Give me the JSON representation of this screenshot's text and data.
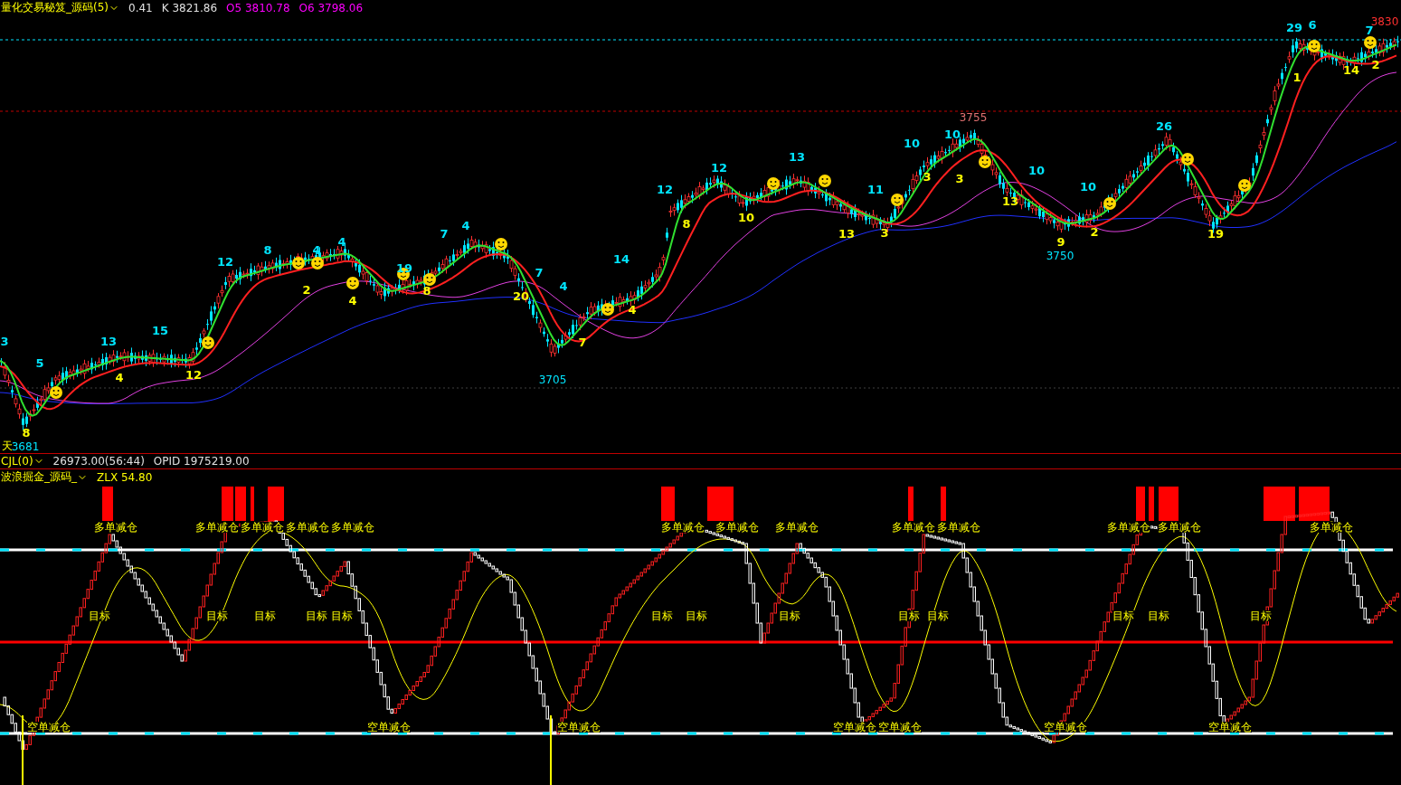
{
  "header": {
    "title": "量化交易秘笈_源码(5)",
    "values": [
      {
        "text": "0.41",
        "color": "#e0e0e0"
      },
      {
        "text": "K 3821.86",
        "color": "#e0e0e0"
      },
      {
        "text": "O5 3810.78",
        "color": "#ff00ff"
      },
      {
        "text": "O6 3798.06",
        "color": "#ff00ff"
      }
    ]
  },
  "main_chart": {
    "peak_labels": [
      "3",
      "5",
      "13",
      "15",
      "12",
      "8",
      "4",
      "4",
      "19",
      "7",
      "4",
      "7",
      "4",
      "14",
      "12",
      "12",
      "13",
      "11",
      "10",
      "10",
      "10",
      "10",
      "26",
      "29",
      "6",
      "7"
    ],
    "trough_labels": [
      "8",
      "4",
      "12",
      "2",
      "4",
      "8",
      "20",
      "7",
      "4",
      "8",
      "10",
      "13",
      "3",
      "3",
      "3",
      "13",
      "9",
      "2",
      "19",
      "1",
      "14",
      "2"
    ],
    "price_labels": [
      {
        "text": "3681",
        "color": "#00e5ff"
      },
      {
        "text": "3705",
        "color": "#00e5ff"
      },
      {
        "text": "3750",
        "color": "#00e5ff"
      },
      {
        "text": "3755",
        "color": "#e07070"
      },
      {
        "text": "3830",
        "color": "#ff3030"
      }
    ],
    "edge_label": "天"
  },
  "volume_bar": {
    "title": "CJL(0)",
    "values": [
      "26973.00(56:44)",
      "OPID 1975219.00"
    ]
  },
  "oscillator": {
    "title": "波浪掘金_源码_",
    "value": "ZLX 54.80",
    "sell_labels": [
      "多单减仓",
      "多单减仓",
      "多单减仓",
      "多单减仓",
      "多单减仓",
      "多单减仓",
      "多单减仓",
      "多单减仓",
      "多单减仓",
      "多单减仓",
      "多单减仓",
      "多单减仓",
      "多单减仓"
    ],
    "target_labels": [
      "目标",
      "目标",
      "目标",
      "目标",
      "目标",
      "目标",
      "目标",
      "目标",
      "目标",
      "目标",
      "目标",
      "目标",
      "目标"
    ],
    "cover_labels": [
      "空单减仓",
      "空单减仓",
      "空单减仓",
      "空单减仓",
      "空单减仓",
      "空单减仓",
      "空单减仓"
    ]
  }
}
